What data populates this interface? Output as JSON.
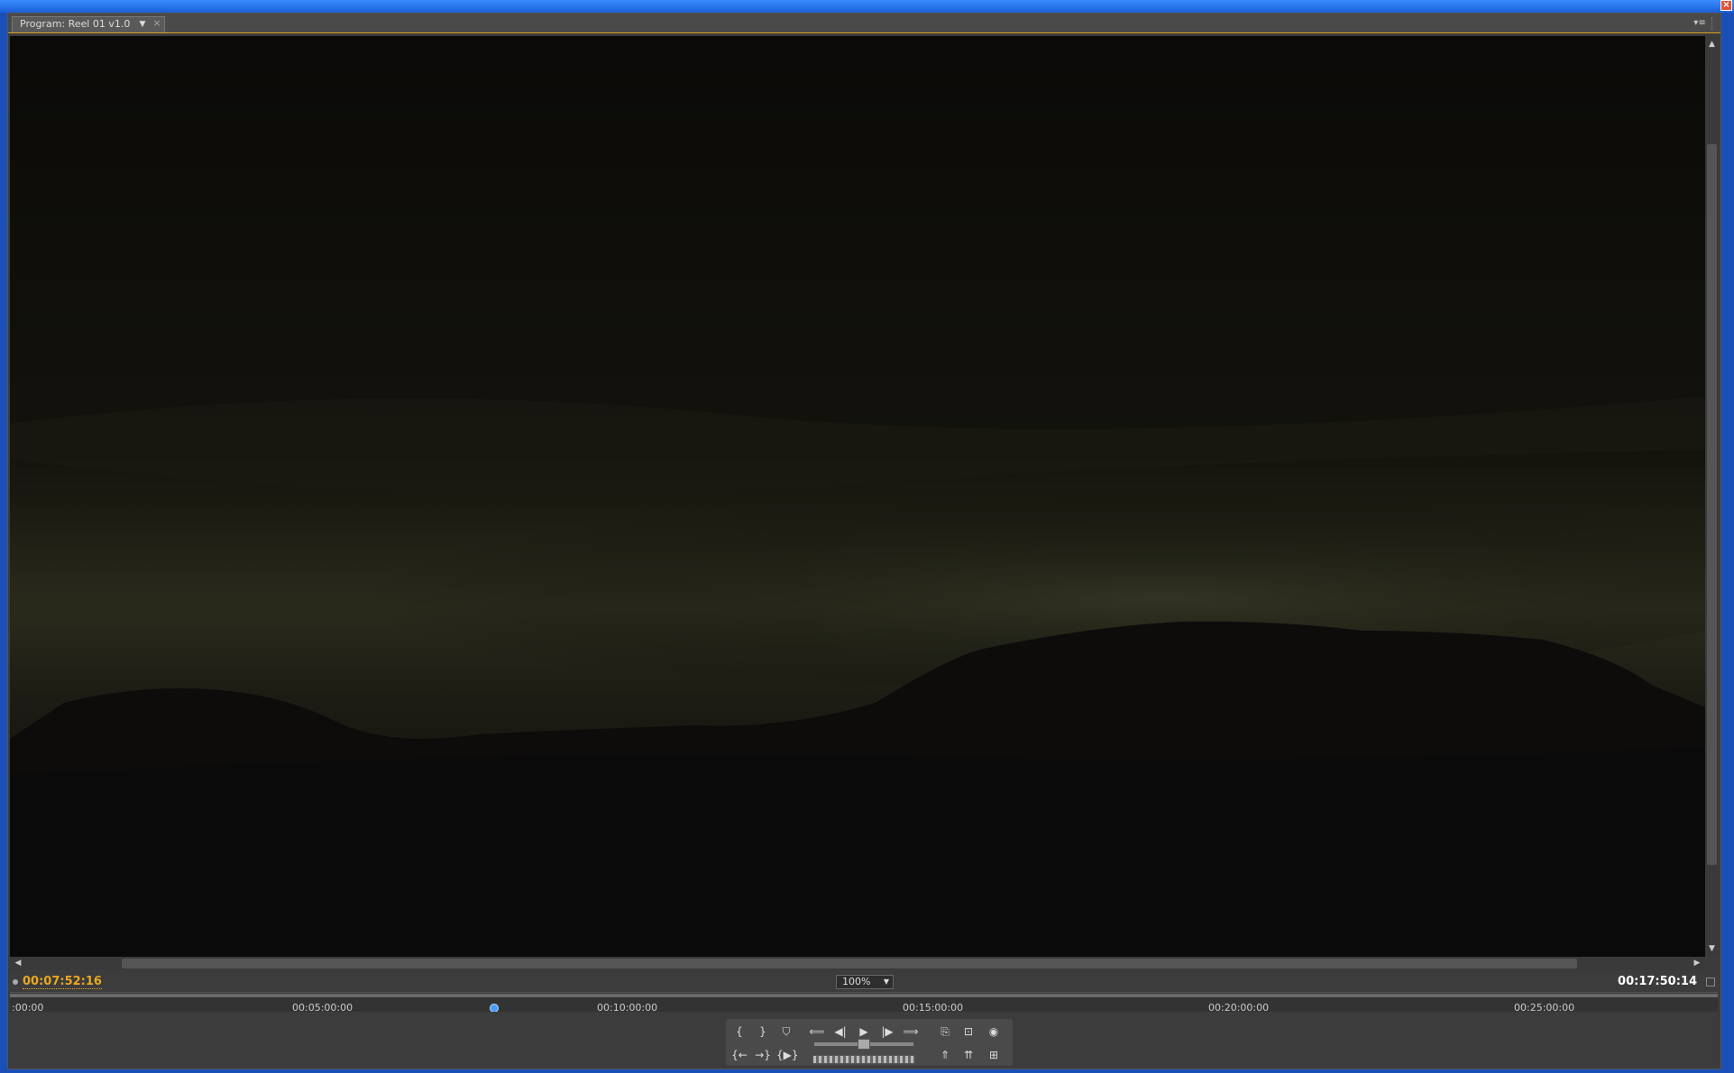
{
  "panel": {
    "tab_label": "Program: Reel 01 v1.0",
    "tab_close": "×",
    "tab_dropdown": "▼",
    "panel_menu": "▾≡"
  },
  "timecode": {
    "current": "00:07:52:16",
    "duration": "00:17:50:14",
    "zoom": "100%"
  },
  "ruler": {
    "ticks": [
      ":00:00",
      "00:05:00:00",
      "00:10:00:00",
      "00:15:00:00",
      "00:20:00:00",
      "00:25:00:00"
    ],
    "playhead_time": "00:07:52:16"
  },
  "controls": {
    "mark_in": "{",
    "mark_out": "}",
    "add_marker": "⛉",
    "go_to_in": "{←",
    "go_to_out": "→}",
    "play_in_to_out": "{▶}",
    "go_prev_edit": "⟸",
    "step_back": "◀|",
    "play": "▶",
    "step_forward": "|▶",
    "go_next_edit": "⟹",
    "export_frame": "⎘",
    "safe_margins": "⊡",
    "output": "◉",
    "lift": "⇑",
    "extract": "⇈",
    "trim": "⊞"
  },
  "colors": {
    "timecode_current": "#e8a820",
    "timecode_duration": "#ffffff",
    "playhead": "#4a9cff",
    "panel_bg": "#3c3c3c",
    "accent_border": "#d8a020"
  }
}
